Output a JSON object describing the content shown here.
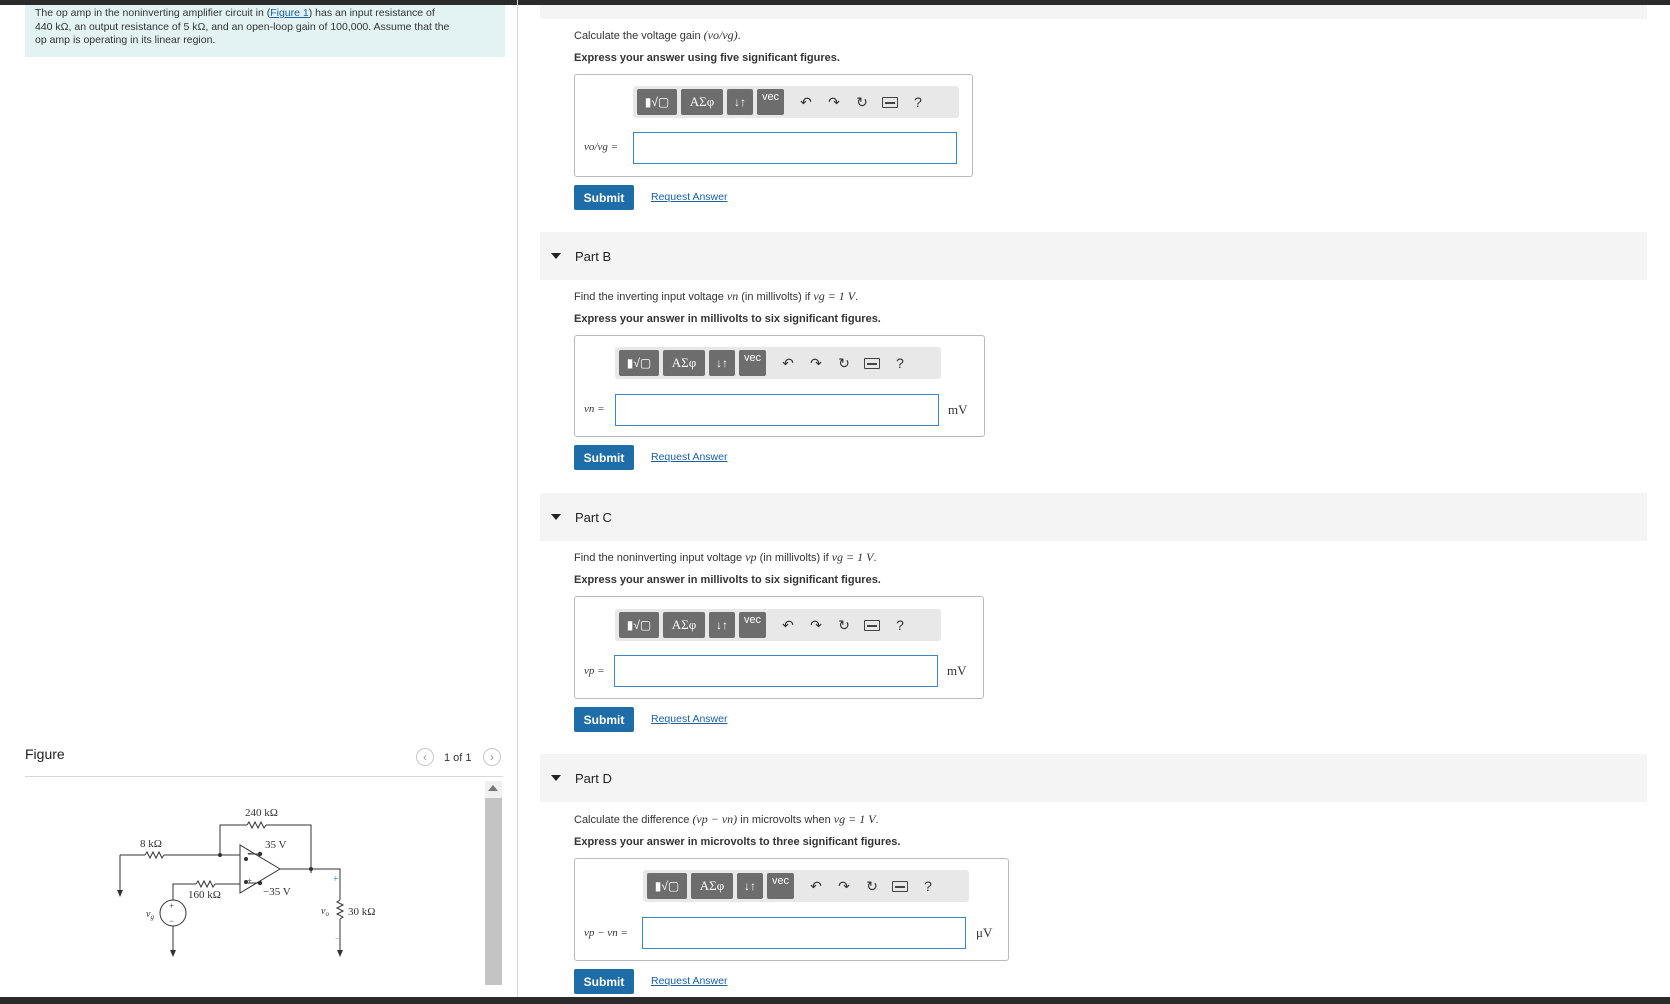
{
  "problem": {
    "text_before_link": "The op amp in the noninverting amplifier circuit in (",
    "link": "Figure 1",
    "line1_rest": ") has an input resistance of",
    "line2": "440 kΩ, an output resistance of 5 kΩ, and an open-loop gain of 100,000. Assume that the",
    "line3": "op amp is operating in its linear region."
  },
  "figure": {
    "label": "Figure",
    "counter": "1 of 1",
    "prev_icon": "chevron-left-icon",
    "next_icon": "chevron-right-icon",
    "labels": {
      "r8k": "8 kΩ",
      "r240k": "240 kΩ",
      "r160k": "160 kΩ",
      "r30k": "30 kΩ",
      "vpos": "35 V",
      "vneg": "−35 V",
      "vg": "v",
      "vg_sub": "g",
      "vo": "v",
      "vo_sub": "o",
      "plus": "+",
      "minus": "−"
    }
  },
  "toolbar": {
    "templates": "▮√▢",
    "greek": "ΑΣφ",
    "arrows": "↓↑",
    "vec": "vec",
    "undo_icon": "undo-icon",
    "redo_icon": "redo-icon",
    "reset_icon": "reset-icon",
    "keyboard_icon": "keyboard-icon",
    "help": "?"
  },
  "buttons": {
    "submit": "Submit",
    "request": "Request Answer"
  },
  "parts": {
    "a": {
      "question_pre": "Calculate the voltage gain ",
      "question_math": "(vo/vg)",
      "question_post": ".",
      "instruction": "Express your answer using five significant figures.",
      "var": "vo/vg =",
      "unit": ""
    },
    "b": {
      "title": "Part B",
      "question_pre": "Find the inverting input voltage ",
      "question_math1": "vn",
      "question_mid": " (in millivolts) if ",
      "question_math2": "vg = 1 V",
      "question_post": ".",
      "instruction": "Express your answer in millivolts to six significant figures.",
      "var": "vn =",
      "unit": "mV"
    },
    "c": {
      "title": "Part C",
      "question_pre": "Find the noninverting input voltage  ",
      "question_math1": "vp",
      "question_mid": " (in millivolts) if ",
      "question_math2": "vg = 1 V",
      "question_post": ".",
      "instruction": "Express your answer in millivolts to six significant figures.",
      "var": "vp =",
      "unit": "mV"
    },
    "d": {
      "title": "Part D",
      "question_pre": "Calculate the difference ",
      "question_math1": "(vp − vn)",
      "question_mid": " in microvolts when ",
      "question_math2": "vg = 1 V",
      "question_post": ".",
      "instruction": "Express your answer in microvolts to three significant figures.",
      "var": "vp − vn =",
      "unit": "μV"
    }
  }
}
